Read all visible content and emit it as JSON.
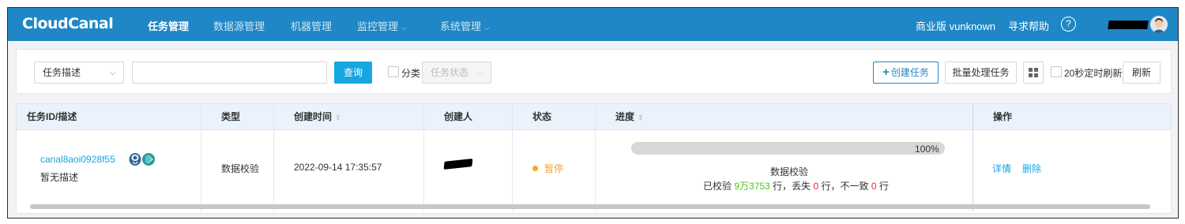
{
  "nav": {
    "logo": "CloudCanal",
    "items": [
      {
        "label": "任务管理",
        "active": true,
        "dropdown": false
      },
      {
        "label": "数据源管理",
        "active": false,
        "dropdown": false
      },
      {
        "label": "机器管理",
        "active": false,
        "dropdown": false
      },
      {
        "label": "监控管理",
        "active": false,
        "dropdown": true
      },
      {
        "label": "系统管理",
        "active": false,
        "dropdown": true
      }
    ],
    "edition": "商业版 vunknown",
    "help": "寻求帮助",
    "help_icon": "?",
    "caret": "⌵"
  },
  "toolbar": {
    "filter_select": "任务描述",
    "search_value": "",
    "search_button": "查询",
    "category_label": "分类",
    "status_select": "任务状态",
    "create_button": "创建任务",
    "create_icon": "+",
    "batch_button": "批量处理任务",
    "auto_refresh_label": "20秒定时刷新",
    "refresh_button": "刷新",
    "select_arrow": "⌵"
  },
  "table": {
    "headers": {
      "id": "任务ID/描述",
      "type": "类型",
      "created": "创建时间",
      "creator": "创建人",
      "status": "状态",
      "progress": "进度",
      "actions": "操作"
    },
    "sort_icon": "⇕",
    "rows": [
      {
        "id": "canal8aoi0928f55",
        "desc": "暂无描述",
        "type": "数据校验",
        "created": "2022-09-14 17:35:57",
        "status": "暂停",
        "progress": {
          "percent": 100,
          "percent_label": "100%",
          "title": "数据校验",
          "checked_prefix": "已校验",
          "checked": "9万3753",
          "lost_prefix": "行，丢失",
          "lost": "0",
          "inconsistent_prefix": "行，不一致",
          "inconsistent": "0",
          "suffix": "行"
        },
        "actions": {
          "detail": "详情",
          "delete": "删除"
        }
      }
    ]
  },
  "colors": {
    "nav_bg": "#1f87c6",
    "primary": "#16a6e2",
    "warning": "#f5a623",
    "success_num": "#52c41a",
    "danger_num": "#f5222d"
  }
}
